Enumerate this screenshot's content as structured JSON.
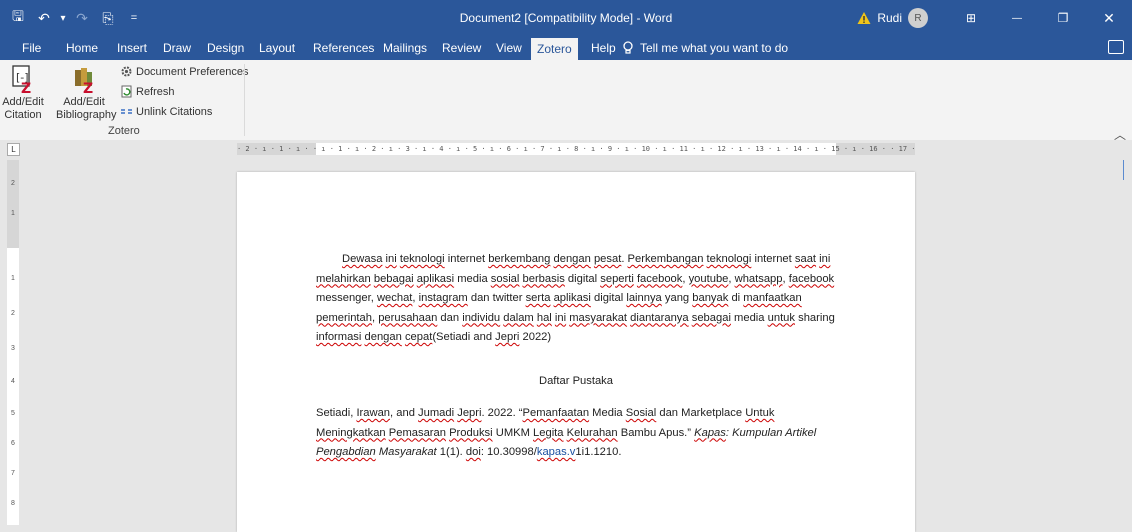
{
  "titlebar": {
    "quick_access": {
      "save": "🖫",
      "undo": "↶",
      "undo_dd": "▾",
      "redo": "↷",
      "touch": "⎘",
      "customize": "="
    },
    "document_title": "Document2 [Compatibility Mode] - Word",
    "user_name": "Rudi",
    "user_initial": "R",
    "window_controls": {
      "ribbon_options": "⊞",
      "minimize": "—",
      "restore": "❐",
      "close": "✕"
    }
  },
  "tabs": [
    {
      "label": "File"
    },
    {
      "label": "Home"
    },
    {
      "label": "Insert"
    },
    {
      "label": "Draw"
    },
    {
      "label": "Design"
    },
    {
      "label": "Layout"
    },
    {
      "label": "References"
    },
    {
      "label": "Mailings"
    },
    {
      "label": "Review"
    },
    {
      "label": "View"
    },
    {
      "label": "Zotero"
    },
    {
      "label": "Help"
    }
  ],
  "active_tab": "Zotero",
  "tell_me": {
    "icon": "lightbulb-icon",
    "placeholder": "Tell me what you want to do"
  },
  "ribbon": {
    "add_edit_citation": [
      "Add/Edit",
      "Citation"
    ],
    "add_edit_bibliography": [
      "Add/Edit",
      "Bibliography"
    ],
    "document_preferences": "Document Preferences",
    "refresh": "Refresh",
    "unlink_citations": "Unlink Citations",
    "group_label": "Zotero"
  },
  "ruler": {
    "horizontal": "· 2 · ı · 1 · ı ·   · ı · 1 · ı · 2 · ı · 3 · ı · 4 · ı · 5 · ı · 6 · ı · 7 · ı · 8 · ı · 9 · ı · 10 · ı · 11 · ı · 12 · ı · 13 · ı · 14 · ı · 15 · ı · 16 ·   · 17 · ı · 18 · ı · 19",
    "vertical": [
      "2",
      "1",
      "1",
      "2",
      "3",
      "4",
      "5",
      "6",
      "7",
      "8"
    ],
    "tab_selector": "L"
  },
  "document": {
    "paragraph_segments": [
      {
        "t": "Dewasa",
        "sq": true
      },
      {
        "t": " "
      },
      {
        "t": "ini",
        "sq": true
      },
      {
        "t": " "
      },
      {
        "t": "teknologi",
        "sq": true
      },
      {
        "t": " internet "
      },
      {
        "t": "berkembang",
        "sq": true
      },
      {
        "t": " "
      },
      {
        "t": "dengan",
        "sq": true
      },
      {
        "t": " "
      },
      {
        "t": "pesat",
        "sq": true
      },
      {
        "t": ". "
      },
      {
        "t": "Perkembangan",
        "sq": true
      },
      {
        "t": " "
      },
      {
        "t": "teknologi",
        "sq": true
      },
      {
        "t": " internet "
      },
      {
        "t": "saat",
        "sq": true
      },
      {
        "t": " "
      },
      {
        "t": "ini",
        "sq": true
      },
      {
        "t": " "
      },
      {
        "t": "melahirkan",
        "sq": true
      },
      {
        "t": " "
      },
      {
        "t": "bebagai",
        "sq": true
      },
      {
        "t": " "
      },
      {
        "t": "aplikasi",
        "sq": true
      },
      {
        "t": " media "
      },
      {
        "t": "sosial",
        "sq": true
      },
      {
        "t": " "
      },
      {
        "t": "berbasis",
        "sq": true
      },
      {
        "t": " digital "
      },
      {
        "t": "seperti",
        "sq": true
      },
      {
        "t": " "
      },
      {
        "t": "facebook",
        "sq": true
      },
      {
        "t": ", "
      },
      {
        "t": "youtube",
        "sq": true
      },
      {
        "t": ", "
      },
      {
        "t": "whatsapp",
        "sq": true
      },
      {
        "t": ", "
      },
      {
        "t": "facebook",
        "sq": true
      },
      {
        "t": " messenger, "
      },
      {
        "t": "wechat",
        "sq": true
      },
      {
        "t": ", "
      },
      {
        "t": "instagram",
        "sq": true
      },
      {
        "t": " dan twitter "
      },
      {
        "t": "serta",
        "sq": true
      },
      {
        "t": " "
      },
      {
        "t": "aplikasi",
        "sq": true
      },
      {
        "t": " digital "
      },
      {
        "t": "lainnya",
        "sq": true
      },
      {
        "t": " yang "
      },
      {
        "t": "banyak",
        "sq": true
      },
      {
        "t": " di "
      },
      {
        "t": "manfaatkan",
        "sq": true
      },
      {
        "t": " "
      },
      {
        "t": "pemerintah",
        "sq": true
      },
      {
        "t": ", "
      },
      {
        "t": "perusahaan",
        "sq": true
      },
      {
        "t": " dan "
      },
      {
        "t": "individu",
        "sq": true
      },
      {
        "t": " "
      },
      {
        "t": "dalam",
        "sq": true
      },
      {
        "t": " "
      },
      {
        "t": "hal",
        "sq": true
      },
      {
        "t": " "
      },
      {
        "t": "ini",
        "sq": true
      },
      {
        "t": " "
      },
      {
        "t": "masyarakat",
        "sq": true
      },
      {
        "t": " "
      },
      {
        "t": "diantaranya",
        "sq": true
      },
      {
        "t": " "
      },
      {
        "t": "sebagai",
        "sq": true
      },
      {
        "t": " media "
      },
      {
        "t": "untuk",
        "sq": true
      },
      {
        "t": " sharing "
      },
      {
        "t": "informasi",
        "sq": true
      },
      {
        "t": " "
      },
      {
        "t": "dengan",
        "sq": true
      },
      {
        "t": " "
      },
      {
        "t": "cepat",
        "sq": true
      },
      {
        "t": "(Setiadi and "
      },
      {
        "t": "Jepri",
        "sq": true
      },
      {
        "t": " 2022)"
      }
    ],
    "bibliography_heading": "Daftar Pustaka",
    "bibliography_segments": [
      {
        "t": "Setiadi, "
      },
      {
        "t": "Irawan",
        "sq": true
      },
      {
        "t": ", and "
      },
      {
        "t": "Jumadi",
        "sq": true
      },
      {
        "t": " "
      },
      {
        "t": "Jepri",
        "sq": true
      },
      {
        "t": ". 2022. “"
      },
      {
        "t": "Pemanfaatan",
        "sq": true
      },
      {
        "t": " Media "
      },
      {
        "t": "Sosial",
        "sq": true
      },
      {
        "t": " dan Marketplace "
      },
      {
        "t": "Untuk",
        "sq": true
      },
      {
        "t": " "
      },
      {
        "t": "Meningkatkan",
        "sq": true
      },
      {
        "t": " "
      },
      {
        "t": "Pemasaran",
        "sq": true
      },
      {
        "t": " "
      },
      {
        "t": "Produksi",
        "sq": true
      },
      {
        "t": " UMKM "
      },
      {
        "t": "Legita",
        "sq": true
      },
      {
        "t": " "
      },
      {
        "t": "Kelurahan",
        "sq": true
      },
      {
        "t": " Bambu Apus.” "
      },
      {
        "t": "Kapas",
        "sq": true,
        "i": true
      },
      {
        "t": ": Kumpulan Artikel ",
        "i": true
      },
      {
        "t": "Pengabdian",
        "sq": true,
        "i": true
      },
      {
        "t": " Masyarakat",
        "i": true
      },
      {
        "t": " 1(1). "
      },
      {
        "t": "doi",
        "sq": true
      },
      {
        "t": ": 10.30998/"
      },
      {
        "t": "kapas.v",
        "sq": true,
        "link": true
      },
      {
        "t": "1i1.1210."
      }
    ]
  }
}
